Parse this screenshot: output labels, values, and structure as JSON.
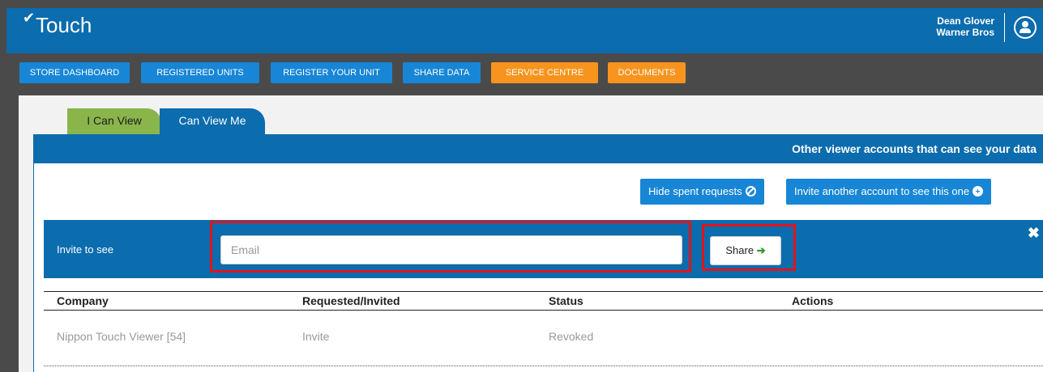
{
  "app": {
    "logo_text": "Touch",
    "logo_tick": "✔"
  },
  "user": {
    "name": "Dean Glover",
    "company": "Warner Bros"
  },
  "nav": [
    {
      "label": "STORE DASHBOARD",
      "color": "#1886d6"
    },
    {
      "label": "REGISTERED UNITS",
      "color": "#1886d6"
    },
    {
      "label": "REGISTER YOUR UNIT",
      "color": "#1886d6"
    },
    {
      "label": "SHARE DATA",
      "color": "#1886d6"
    },
    {
      "label": "SERVICE CENTRE",
      "color": "#f7941d"
    },
    {
      "label": "DOCUMENTS",
      "color": "#f7941d"
    }
  ],
  "tabs": [
    {
      "label": "I Can View"
    },
    {
      "label": "Can View Me"
    }
  ],
  "panel": {
    "title": "Other viewer accounts that can see your data",
    "hide_label": "Hide spent requests",
    "invite_label": "Invite another account to see this one"
  },
  "invite": {
    "label": "Invite to see",
    "email_placeholder": "Email",
    "email_value": "",
    "share_label": "Share",
    "close_glyph": "✖"
  },
  "table": {
    "headers": [
      "Company",
      "Requested/Invited",
      "Status",
      "Actions"
    ],
    "rows": [
      [
        "Nippon Touch Viewer [54]",
        "Invite",
        "Revoked",
        ""
      ]
    ]
  },
  "colors": {
    "primary": "#0b6cae",
    "nav_blue": "#1886d6",
    "nav_orange": "#f7941d",
    "tab_green": "#8ab54b",
    "highlight": "#e0141c"
  }
}
